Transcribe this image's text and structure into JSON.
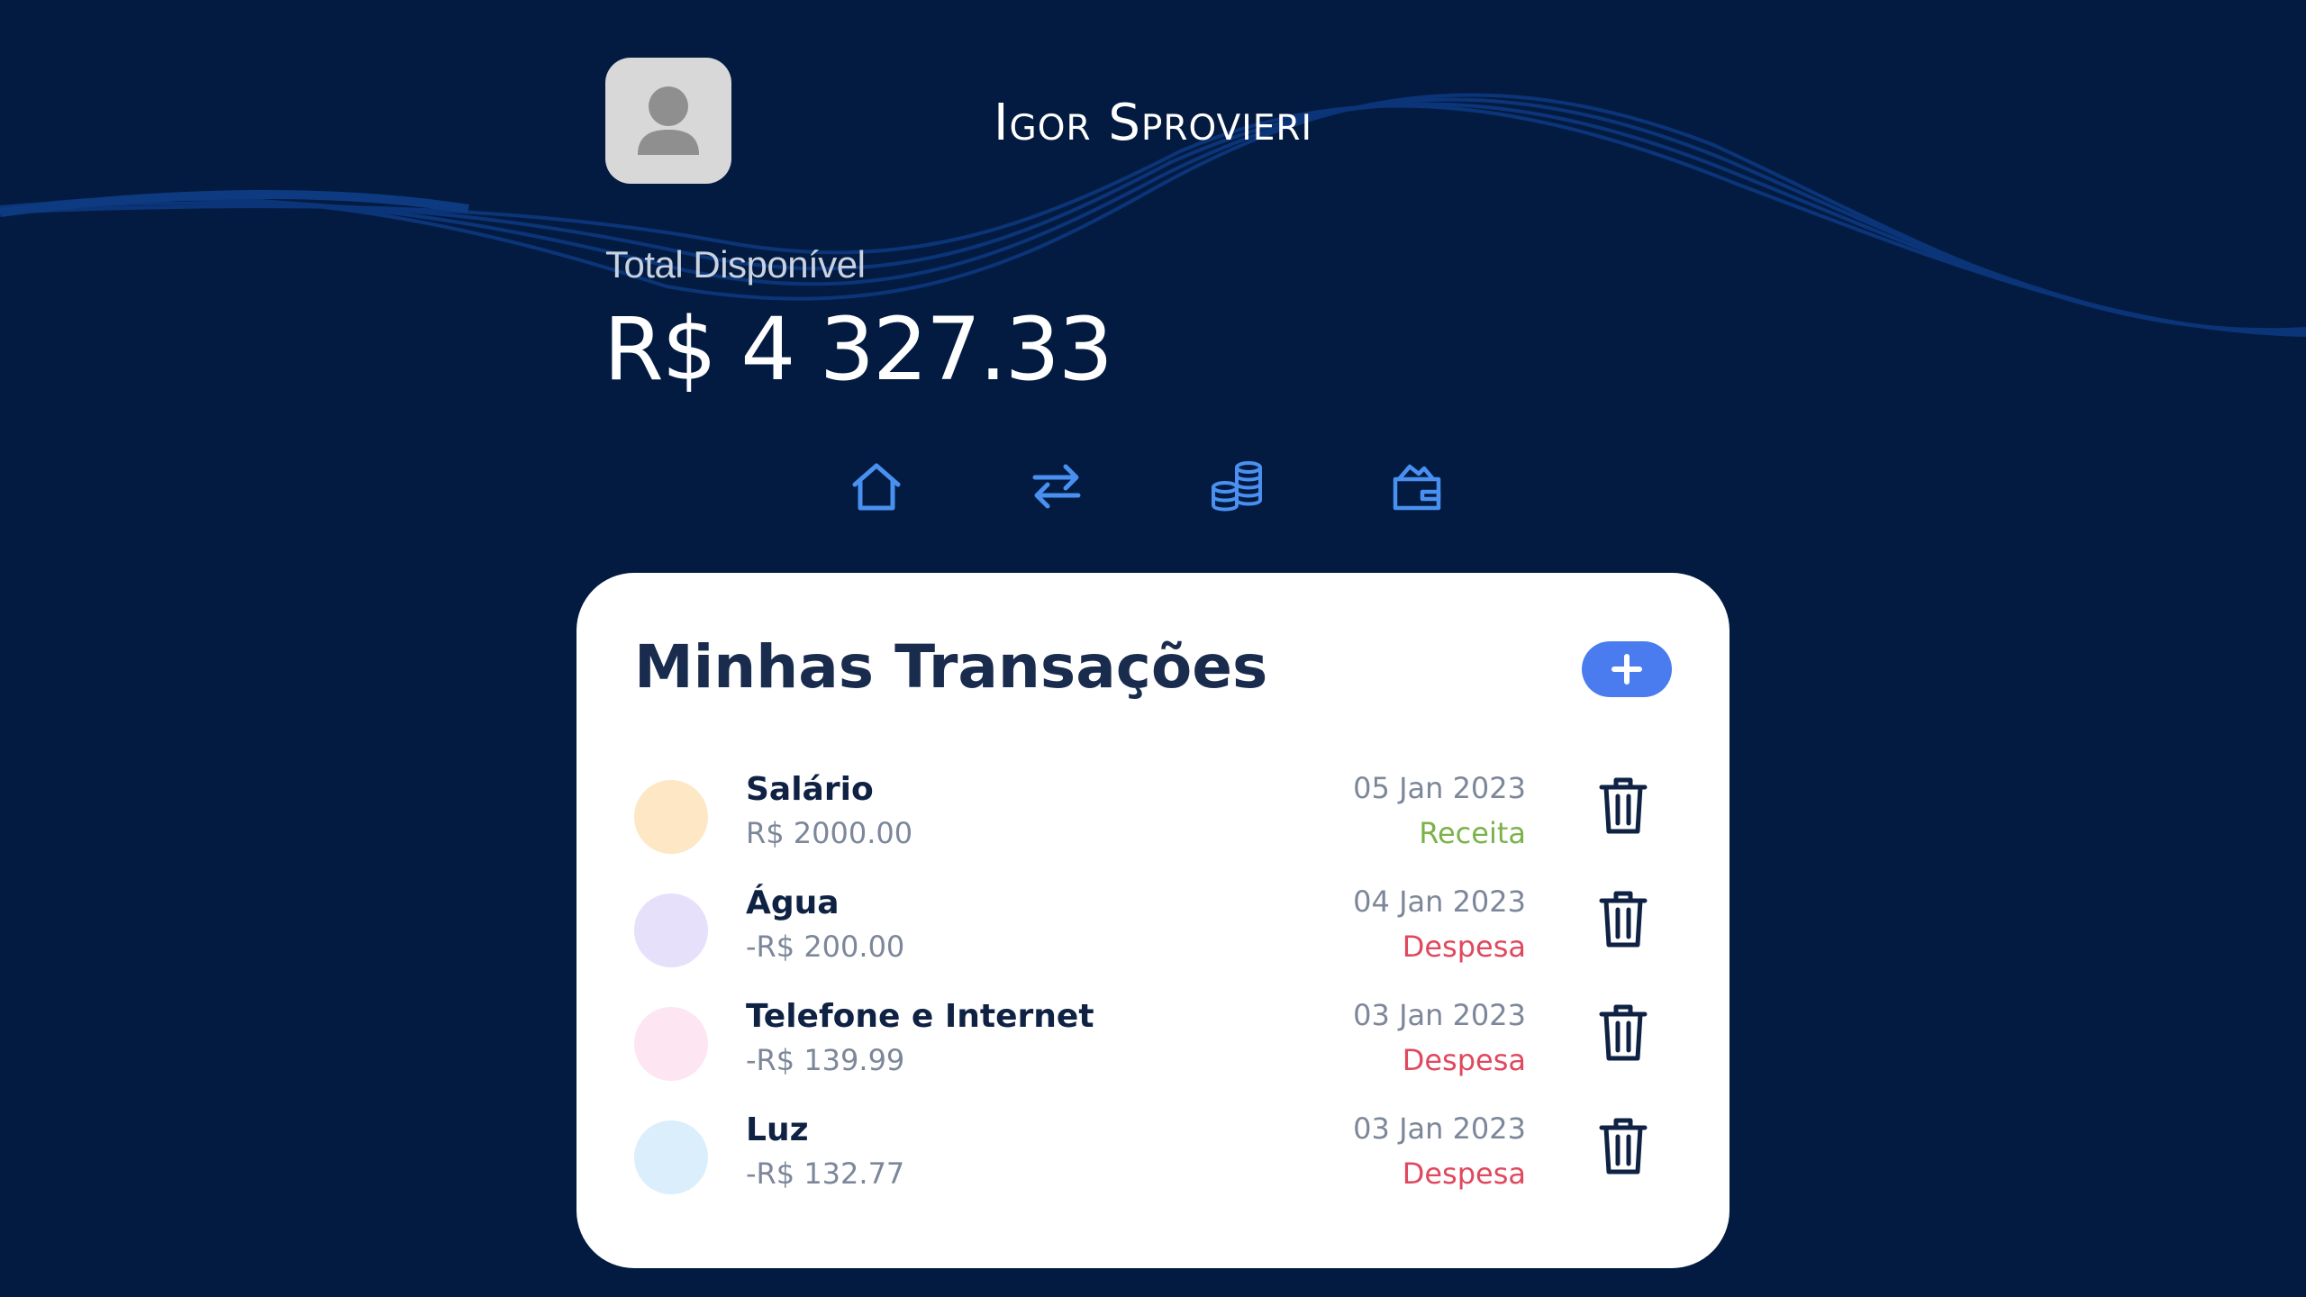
{
  "user": {
    "name": "Igor Sprovieri",
    "avatar_icon": "user-silhouette-icon"
  },
  "balance": {
    "label": "Total Disponível",
    "value": "R$ 4 327.33"
  },
  "nav": {
    "items": [
      {
        "icon": "home-icon"
      },
      {
        "icon": "transfer-arrows-icon"
      },
      {
        "icon": "coins-icon"
      },
      {
        "icon": "wallet-icon"
      }
    ],
    "icon_color": "#4a90f0"
  },
  "transactions": {
    "title": "Minhas Transações",
    "add_icon": "plus-icon",
    "items": [
      {
        "name": "Salário",
        "amount": "R$ 2000.00",
        "date": "05 Jan 2023",
        "type": "Receita",
        "dot_color": "#fde7c4",
        "type_color": "#7cb24a"
      },
      {
        "name": "Água",
        "amount": "-R$ 200.00",
        "date": "04 Jan 2023",
        "type": "Despesa",
        "dot_color": "#e6e0fb",
        "type_color": "#e0485e"
      },
      {
        "name": "Telefone e Internet",
        "amount": "-R$ 139.99",
        "date": "03 Jan 2023",
        "type": "Despesa",
        "dot_color": "#fde6f1",
        "type_color": "#e0485e"
      },
      {
        "name": "Luz",
        "amount": "-R$ 132.77",
        "date": "03 Jan 2023",
        "type": "Despesa",
        "dot_color": "#daeefc",
        "type_color": "#e0485e"
      }
    ]
  },
  "colors": {
    "background": "#031b41",
    "wave": "#0d3a80",
    "card": "#ffffff",
    "accent": "#4a7cf0"
  }
}
